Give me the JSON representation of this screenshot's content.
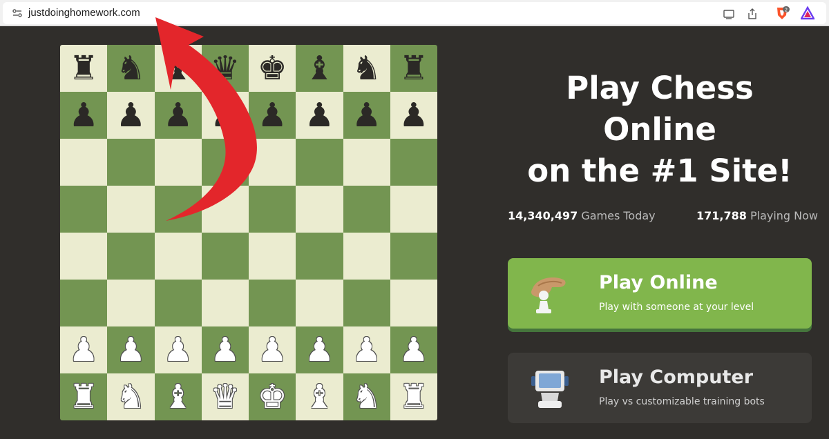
{
  "browser": {
    "url": "justdoinghomework.com",
    "icons": [
      "site-info-icon",
      "cast-icon",
      "share-icon",
      "brave-shield-icon",
      "brave-rewards-icon"
    ],
    "shield_count": "2"
  },
  "board": {
    "light_color": "#ebecd0",
    "dark_color": "#739552",
    "rows": [
      [
        "♜",
        "♞",
        "♝",
        "♛",
        "♚",
        "♝",
        "♞",
        "♜"
      ],
      [
        "♟",
        "♟",
        "♟",
        "♟",
        "♟",
        "♟",
        "♟",
        "♟"
      ],
      [
        "",
        "",
        "",
        "",
        "",
        "",
        "",
        ""
      ],
      [
        "",
        "",
        "",
        "",
        "",
        "",
        "",
        ""
      ],
      [
        "",
        "",
        "",
        "",
        "",
        "",
        "",
        ""
      ],
      [
        "",
        "",
        "",
        "",
        "",
        "",
        "",
        ""
      ],
      [
        "♟",
        "♟",
        "♟",
        "♟",
        "♟",
        "♟",
        "♟",
        "♟"
      ],
      [
        "♜",
        "♞",
        "♝",
        "♛",
        "♚",
        "♝",
        "♞",
        "♜"
      ]
    ],
    "piece_colors": [
      "black",
      "black",
      "none",
      "none",
      "none",
      "none",
      "white",
      "white"
    ]
  },
  "hero": {
    "line1": "Play Chess",
    "line2": "Online",
    "line3": "on the #1 Site!"
  },
  "stats": {
    "games_today_value": "14,340,497",
    "games_today_label": "Games Today",
    "playing_now_value": "171,788",
    "playing_now_label": "Playing Now"
  },
  "buttons": {
    "play_online_title": "Play Online",
    "play_online_sub": "Play with someone at your level",
    "play_computer_title": "Play Computer",
    "play_computer_sub": "Play vs customizable training bots"
  },
  "colors": {
    "background": "#302e2b",
    "accent_green": "#81b64c",
    "arrow_red": "#e3262b"
  }
}
